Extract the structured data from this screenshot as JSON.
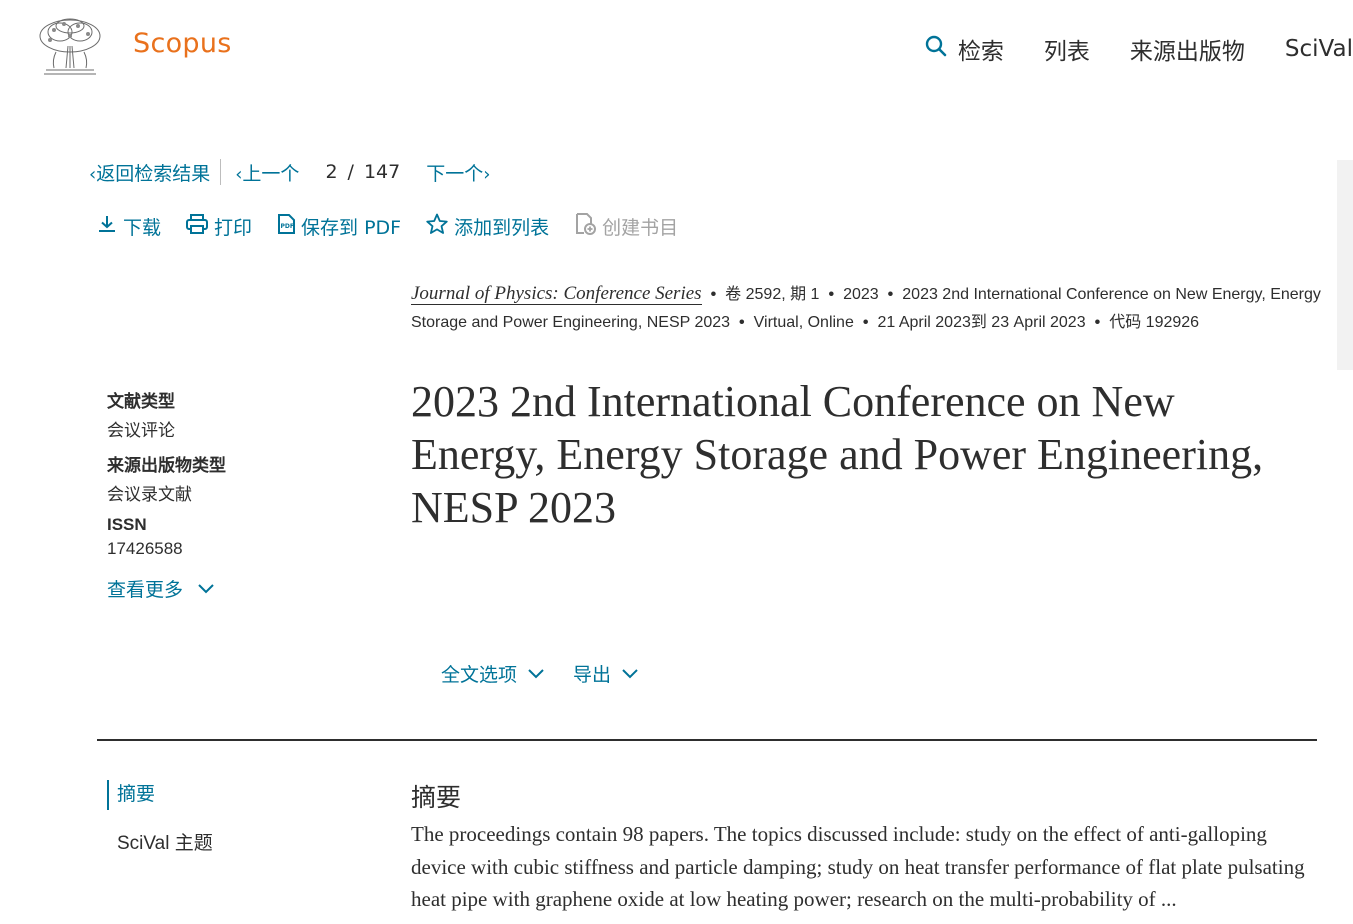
{
  "header": {
    "brand": "Scopus",
    "nav": [
      {
        "label": "检索",
        "icon": "search-icon"
      },
      {
        "label": "列表"
      },
      {
        "label": "来源出版物"
      },
      {
        "label": "SciVal"
      }
    ]
  },
  "pager": {
    "back_label": "返回检索结果",
    "prev_label": "上一个",
    "current": "2",
    "separator": "/",
    "total": "147",
    "next_label": "下一个"
  },
  "actions": {
    "download": "下载",
    "print": "打印",
    "save_pdf": "保存到 PDF",
    "add_to_list": "添加到列表",
    "create_bibliography": "创建书目"
  },
  "source": {
    "journal": "Journal of Physics: Conference Series",
    "volume_issue": "卷 2592, 期 1",
    "year": "2023",
    "conference": "2023 2nd International Conference on New Energy, Energy Storage and Power Engineering, NESP 2023",
    "location": "Virtual, Online",
    "dates": "21 April 2023到 23 April 2023",
    "code": "代码 192926"
  },
  "meta": {
    "doc_type_label": "文献类型",
    "doc_type_value": "会议评论",
    "source_type_label": "来源出版物类型",
    "source_type_value": "会议录文献",
    "issn_label": "ISSN",
    "issn_value": "17426588",
    "see_more": "查看更多"
  },
  "title": "2023 2nd International Conference on New Energy, Energy Storage and Power Engineering, NESP 2023",
  "options": {
    "full_text": "全文选项",
    "export": "导出"
  },
  "section_nav": {
    "abstract": "摘要",
    "scival": "SciVal 主题"
  },
  "abstract": {
    "heading": "摘要",
    "text": "The proceedings contain 98 papers. The topics discussed include: study on the effect of anti-galloping device with cubic stiffness and particle damping; study on heat transfer performance of flat plate pulsating heat pipe with graphene oxide at low heating power; research on the multi-probability of ..."
  },
  "colors": {
    "accent": "#007398",
    "brand": "#e9711c",
    "text": "#2e2e2e",
    "disabled": "#a3a3a3"
  }
}
